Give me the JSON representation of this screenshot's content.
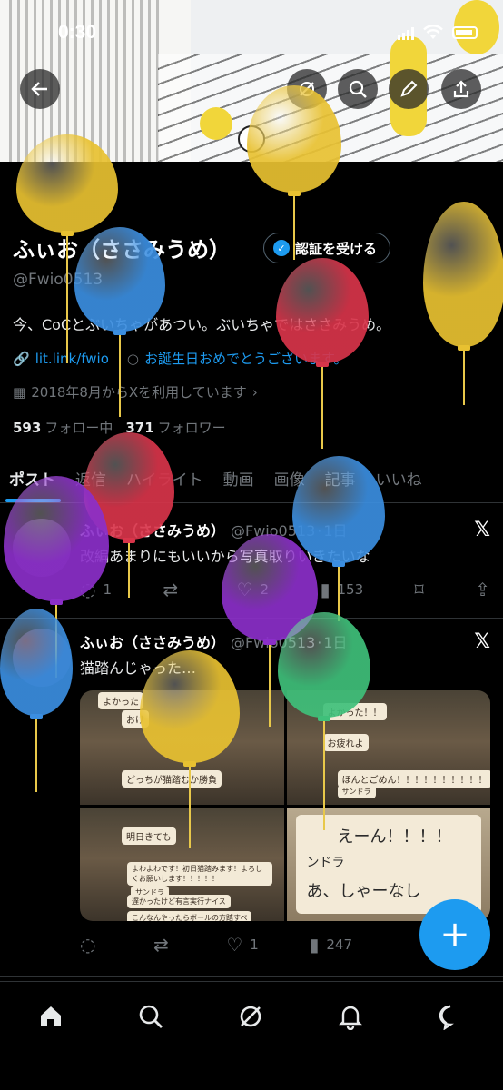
{
  "status": {
    "time": "0:30"
  },
  "header": {
    "back_icon": "arrow-left-icon",
    "actions": [
      "grok-icon",
      "search-icon",
      "edit-icon",
      "share-icon"
    ]
  },
  "profile": {
    "display_name": "ふぃお（ささみうめ）",
    "verify_label": "認証を受ける",
    "handle": "@Fwio0513",
    "bio": "今、CoCとぶいちゃがあつい。ぶいちゃではささみうめ。",
    "link": "lit.link/fwio",
    "birthday": "お誕生日おめでとうございます。",
    "joined": "2018年8月からXを利用しています",
    "following_count": "593",
    "following_label": "フォロー中",
    "followers_count": "371",
    "followers_label": "フォロワー"
  },
  "tabs": [
    "ポスト",
    "返信",
    "ハイライト",
    "動画",
    "画像",
    "記事",
    "いいね"
  ],
  "posts": [
    {
      "name": "ふぃお（ささみうめ）",
      "handle": "@Fwio0513",
      "time": "1日",
      "text": "改編あまりにもいいから写真取りいきたいな",
      "reply": "1",
      "retweet": "",
      "like": "2",
      "views": "153"
    },
    {
      "name": "ふぃお（ささみうめ）",
      "handle": "@Fwio0513",
      "time": "1日",
      "text": "猫踏んじゃった…",
      "reply": "",
      "retweet": "",
      "like": "1",
      "views": "247",
      "media": {
        "c1": [
          "よかった",
          "おけ",
          "どっちが猫踏むか勝負"
        ],
        "c2": [
          "よかった！！",
          "お疲れよ",
          "ほんとごめん！！！！！！！！！！",
          "サンドラ"
        ],
        "c3": [
          "明日きても",
          "よわよわです！初日猫踏みます！よろしくお願いします！！！！！",
          "サンドラ",
          "遅かったけど有言実行ナイス",
          "こんなんやったらボールの方踏すべ"
        ],
        "c4": [
          "えーん！！！！",
          "ンドラ",
          "あ、しゃーなし"
        ]
      }
    }
  ],
  "nav": [
    "home-icon",
    "search-icon",
    "grok-icon",
    "notifications-icon",
    "messages-icon"
  ],
  "colors": {
    "accent": "#1d9bf0",
    "balloon_yellow": "#e8c131",
    "balloon_blue": "#3b8ee0",
    "balloon_red": "#d8344a",
    "balloon_purple": "#8b2fc9",
    "balloon_green": "#3fc07a"
  }
}
